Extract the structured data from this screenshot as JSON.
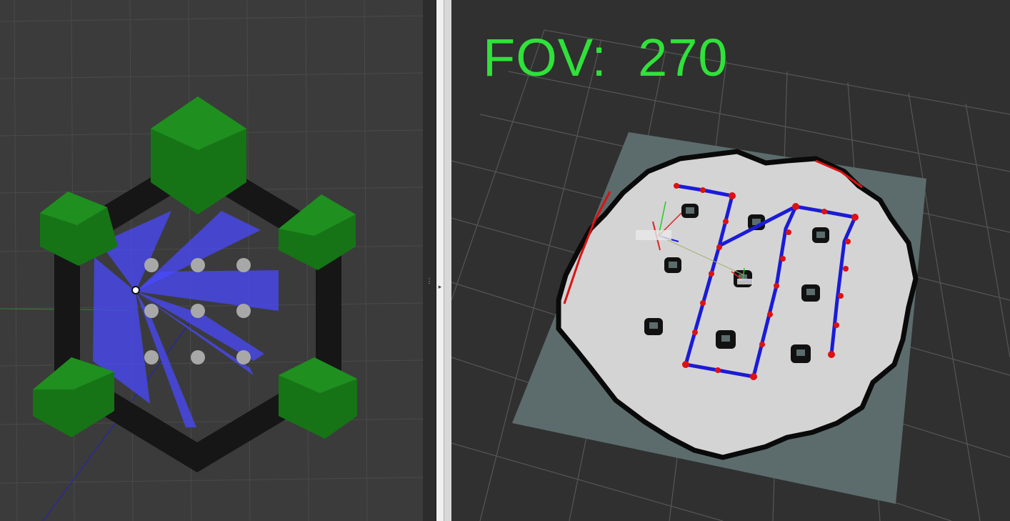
{
  "left_panel": {
    "view": "gazebo-simulation-3d-view",
    "colors": {
      "background": "#3b3b3b",
      "grid": "#4a4a4a",
      "wall": "#161616",
      "cube": "#1a7f1a",
      "laser": "#4040ff",
      "pillar": "#9c9c9c"
    }
  },
  "right_panel": {
    "view": "rviz-map-3d-view",
    "fov_label": "FOV:",
    "fov_value": "270",
    "colors": {
      "background": "#303030",
      "grid": "#555555",
      "map_unknown": "#5c6c6c",
      "map_free": "#d3d3d3",
      "map_occupied": "#000000",
      "path": "#1b1bd8",
      "waypoint": "#dd1111",
      "text": "#2fe23a"
    }
  },
  "splitter": {
    "handle_glyph": "⋮",
    "arrow_glyph": "▸"
  }
}
